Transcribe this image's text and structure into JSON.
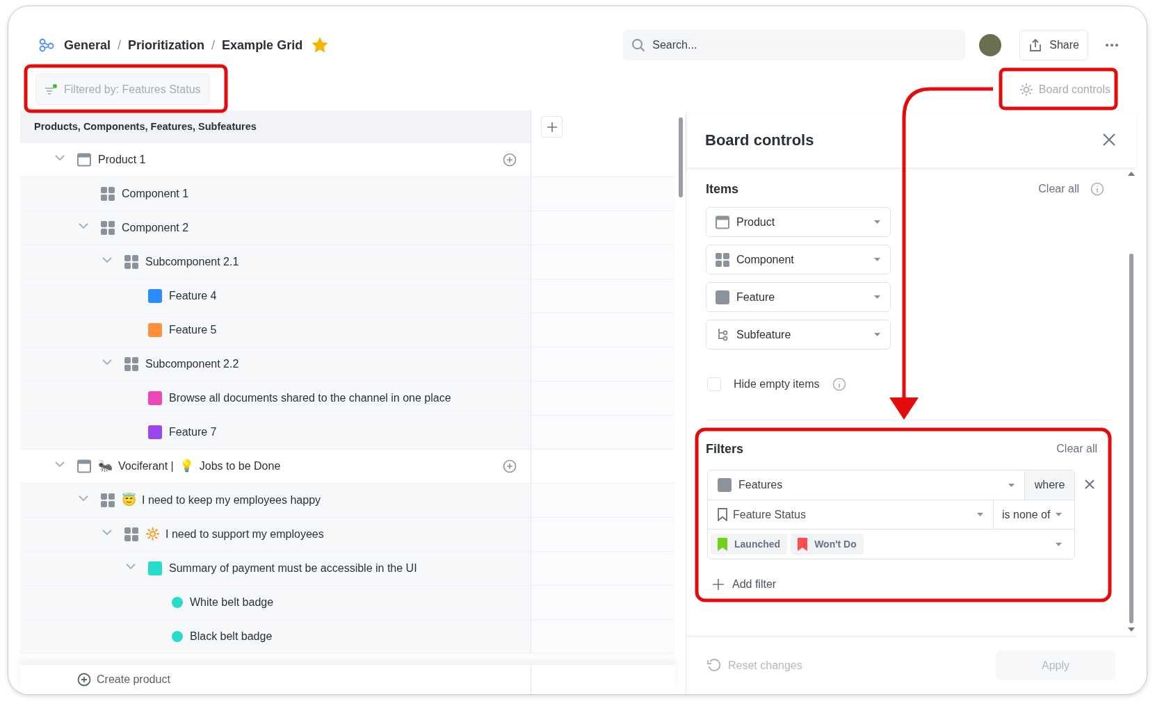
{
  "breadcrumb": [
    {
      "kind": "link",
      "text": "General"
    },
    {
      "kind": "separator",
      "text": "/"
    },
    {
      "kind": "link",
      "text": "Prioritization"
    },
    {
      "kind": "separator",
      "text": "/"
    },
    {
      "kind": "current",
      "text": "Example Grid"
    }
  ],
  "favorite": true,
  "search": {
    "placeholder": "Search..."
  },
  "share_button": "Share",
  "filter_chip": {
    "label": "Filtered by: Features Status",
    "active": true
  },
  "board_controls_button": "Board controls",
  "tree": {
    "header": "Products, Components, Features, Subfeatures",
    "rows": [
      {
        "kind": "product",
        "parts": [
          {
            "kind": "text",
            "text": "Product 1"
          }
        ],
        "expanded": true,
        "children": [
          {
            "kind": "component",
            "parts": [
              {
                "kind": "text",
                "text": "Component 1"
              }
            ]
          },
          {
            "kind": "component",
            "parts": [
              {
                "kind": "text",
                "text": "Component 2"
              }
            ],
            "expanded": true,
            "children": [
              {
                "kind": "component",
                "parts": [
                  {
                    "kind": "text",
                    "text": "Subcomponent 2.1"
                  }
                ],
                "expanded": true,
                "children": [
                  {
                    "kind": "feature",
                    "color": "#2b8cff",
                    "parts": [
                      {
                        "kind": "text",
                        "text": "Feature 4"
                      }
                    ]
                  },
                  {
                    "kind": "feature",
                    "color": "#ff8f3a",
                    "parts": [
                      {
                        "kind": "text",
                        "text": "Feature 5"
                      }
                    ]
                  }
                ]
              },
              {
                "kind": "component",
                "parts": [
                  {
                    "kind": "text",
                    "text": "Subcomponent 2.2"
                  }
                ],
                "expanded": true,
                "children": [
                  {
                    "kind": "feature",
                    "color": "#ec47b9",
                    "parts": [
                      {
                        "kind": "text",
                        "text": "Browse all documents shared to the channel in one place"
                      }
                    ]
                  },
                  {
                    "kind": "feature",
                    "color": "#9b47ec",
                    "parts": [
                      {
                        "kind": "text",
                        "text": "Feature 7"
                      }
                    ]
                  }
                ]
              }
            ]
          }
        ]
      },
      {
        "kind": "product",
        "parts": [
          {
            "kind": "emoji",
            "text": "🐜"
          },
          {
            "kind": "text",
            "text": "Vociferant |"
          },
          {
            "kind": "emoji",
            "text": "💡"
          },
          {
            "kind": "text",
            "text": "Jobs to be Done"
          }
        ],
        "expanded": true,
        "children": [
          {
            "kind": "component",
            "parts": [
              {
                "kind": "emoji",
                "text": "😇"
              },
              {
                "kind": "text",
                "text": "I need to keep my employees happy"
              }
            ],
            "expanded": true,
            "children": [
              {
                "kind": "component",
                "parts": [
                  {
                    "kind": "emoji",
                    "text": "🔆"
                  },
                  {
                    "kind": "text",
                    "text": "I need to support my employees"
                  }
                ],
                "expanded": true,
                "children": [
                  {
                    "kind": "feature",
                    "color": "#27dcc8",
                    "parts": [
                      {
                        "kind": "text",
                        "text": "Summary of payment must be accessible in the UI"
                      }
                    ],
                    "expanded": true,
                    "children": [
                      {
                        "kind": "subfeature",
                        "color": "#27dcc8",
                        "parts": [
                          {
                            "kind": "text",
                            "text": "White belt badge"
                          }
                        ]
                      },
                      {
                        "kind": "subfeature",
                        "color": "#27dcc8",
                        "parts": [
                          {
                            "kind": "text",
                            "text": "Black belt badge"
                          }
                        ]
                      }
                    ]
                  }
                ]
              }
            ]
          }
        ]
      }
    ],
    "create_button": "Create product"
  },
  "panel": {
    "title": "Board controls",
    "items": {
      "title": "Items",
      "clear": "Clear all",
      "selects": [
        {
          "kind": "product",
          "label": "Product"
        },
        {
          "kind": "component",
          "label": "Component"
        },
        {
          "kind": "feature",
          "label": "Feature"
        },
        {
          "kind": "subfeature",
          "label": "Subfeature"
        }
      ],
      "hide_empty": {
        "label": "Hide empty items",
        "checked": false
      }
    },
    "filters": {
      "title": "Filters",
      "clear": "Clear all",
      "entity": "Features",
      "connector": "where",
      "field": "Feature Status",
      "operator": "is none of",
      "values": [
        {
          "label": "Launched",
          "color": "#6fd11c"
        },
        {
          "label": "Won't Do",
          "color": "#ff4b55"
        }
      ],
      "add": "Add filter"
    },
    "footer": {
      "reset": {
        "label": "Reset changes",
        "disabled": true
      },
      "apply": {
        "label": "Apply",
        "disabled": true
      }
    }
  }
}
